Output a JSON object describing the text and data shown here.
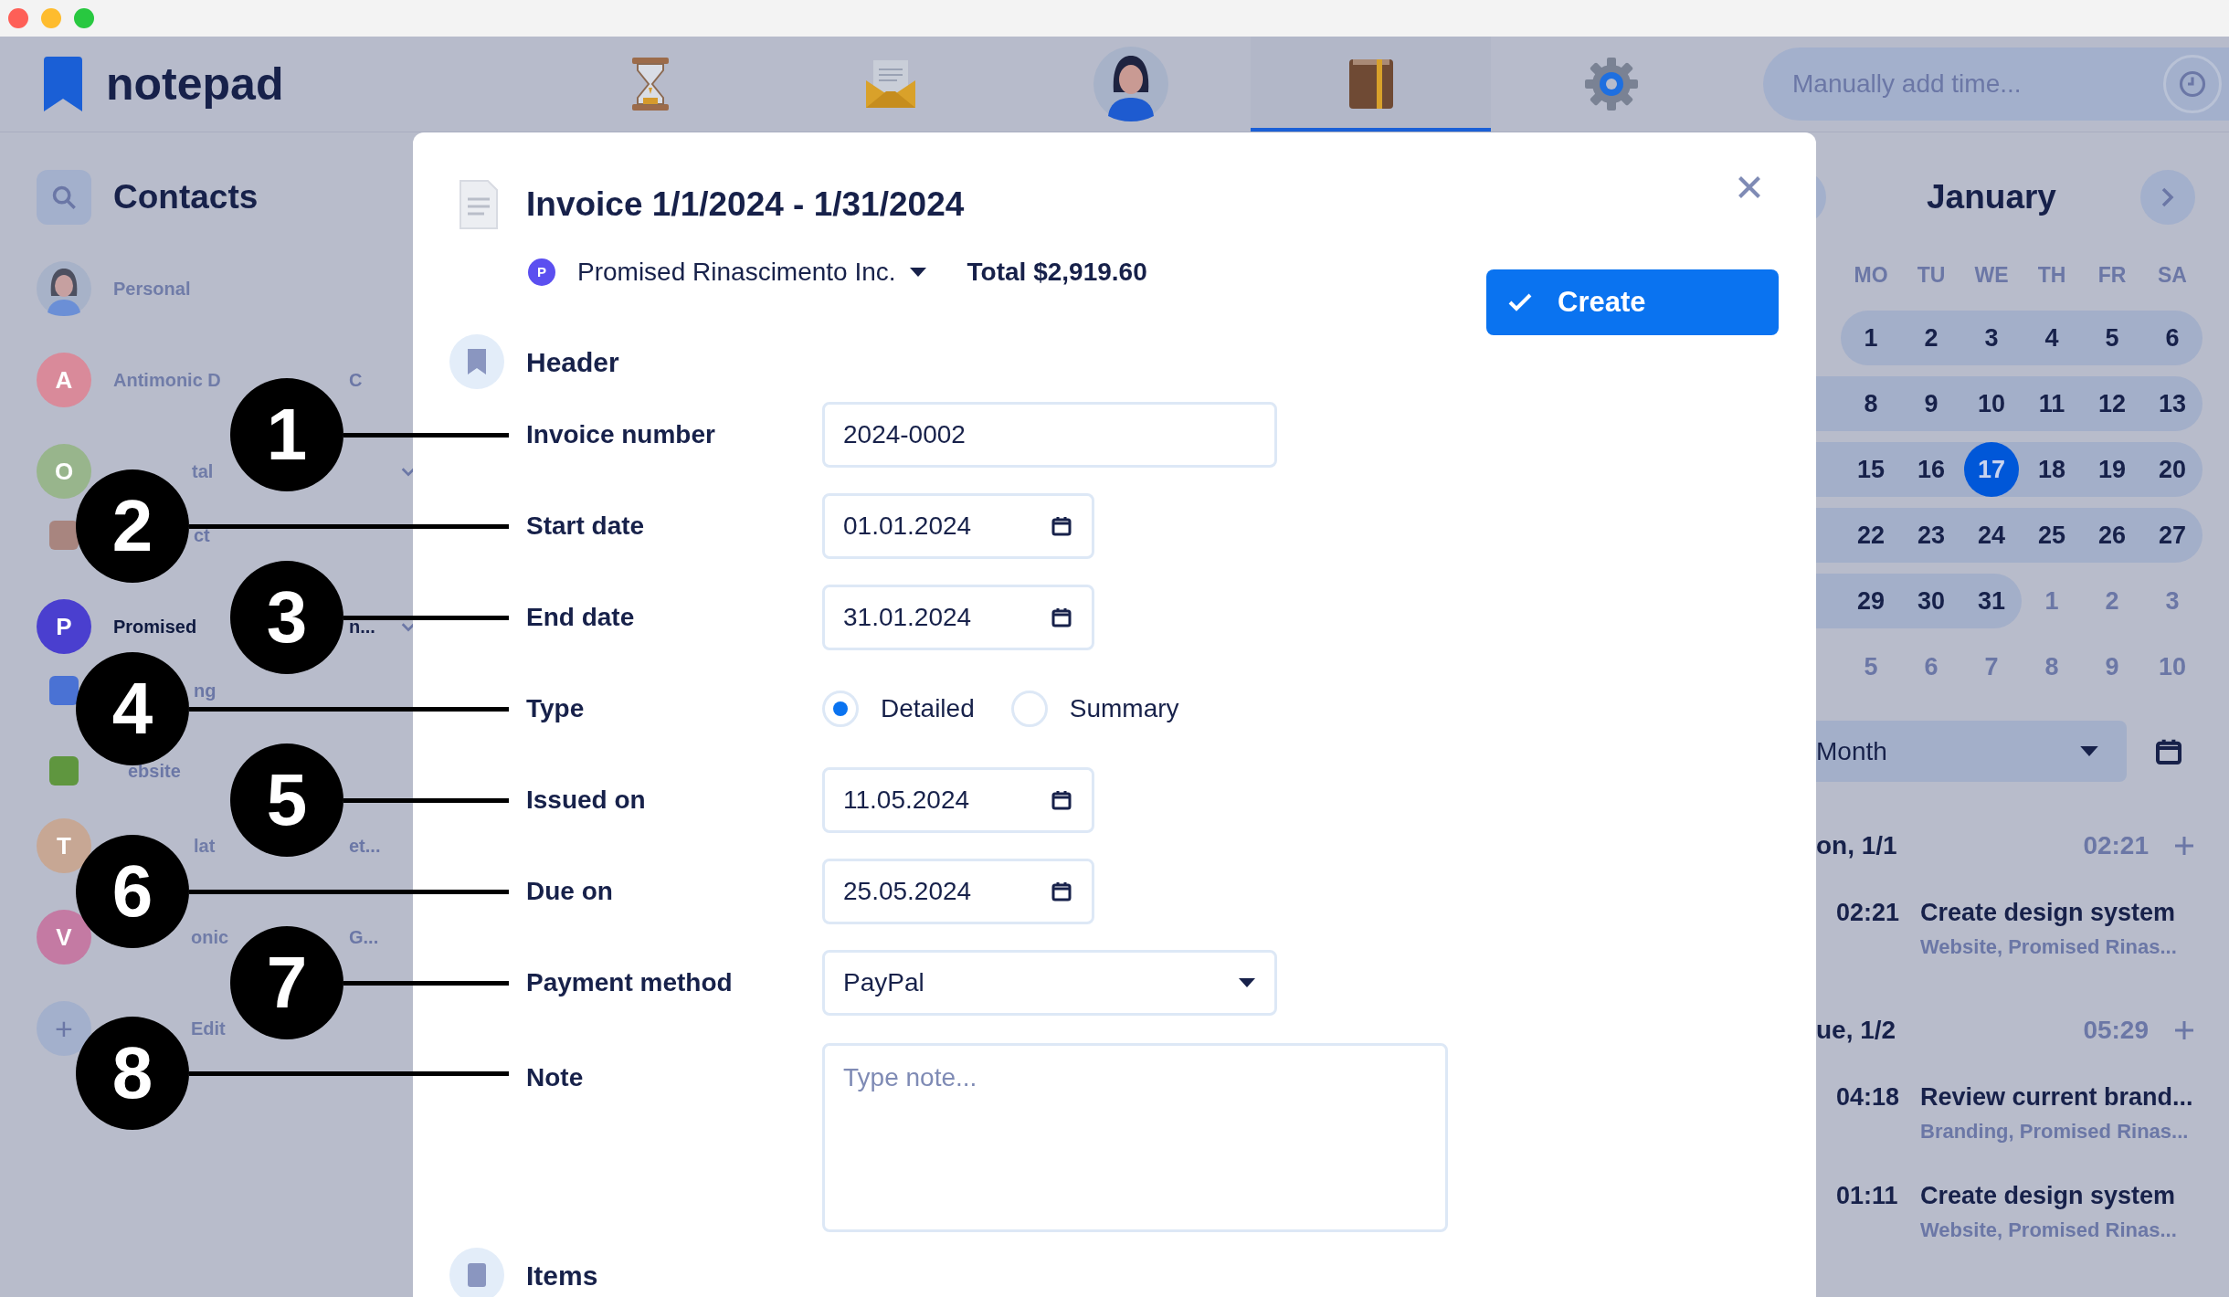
{
  "app_bar": {
    "logo": "notepad",
    "nav": [
      {
        "kind": "hourglass",
        "selected": false
      },
      {
        "kind": "envelope",
        "selected": false
      },
      {
        "kind": "avatar",
        "selected": false
      },
      {
        "kind": "book",
        "selected": true
      },
      {
        "kind": "gear",
        "selected": false
      }
    ],
    "time_field": {
      "placeholder": "Manually add time..."
    }
  },
  "sidebar": {
    "title": "Contacts",
    "items": [
      {
        "kind": "photo",
        "label": "Personal",
        "selected": false
      },
      {
        "kind": "letter",
        "initial": "A",
        "color": "#d98a9a",
        "label": "Antimonic D",
        "tail": "C",
        "selected": false
      },
      {
        "kind": "letter",
        "initial": "O",
        "color": "#98b58c",
        "label": "tal",
        "selected": false,
        "expanded": true,
        "children": [
          {
            "color": "#a8857f",
            "label": "ct"
          }
        ]
      },
      {
        "kind": "letter",
        "initial": "P",
        "color": "#4a3fcf",
        "label": "Promised",
        "tail": "n...",
        "selected": true,
        "expanded": true,
        "children": [
          {
            "color": "#4a72d4",
            "label": "ng"
          },
          {
            "color": "#5f963f",
            "label": "ebsite"
          }
        ]
      },
      {
        "kind": "letter",
        "initial": "T",
        "color": "#c7a794",
        "label": "lat",
        "tail": "et...",
        "selected": false
      },
      {
        "kind": "letter",
        "initial": "V",
        "color": "#c47aa3",
        "label": "onic",
        "tail": "G...",
        "selected": false
      },
      {
        "kind": "add",
        "initial": "+",
        "label": "Edit",
        "selected": false
      }
    ]
  },
  "modal": {
    "title": "Invoice 1/1/2024 - 1/31/2024",
    "client": {
      "initial": "P",
      "color": "#5b4ff0",
      "name": "Promised Rinascimento Inc."
    },
    "total": "Total $2,919.60",
    "create_button": "Create",
    "header_section": "Header",
    "fields": [
      {
        "callout": "1",
        "label": "Invoice number",
        "kind": "text",
        "value": "2024-0002"
      },
      {
        "callout": "2",
        "label": "Start date",
        "kind": "date",
        "value": "01.01.2024"
      },
      {
        "callout": "3",
        "label": "End date",
        "kind": "date",
        "value": "31.01.2024"
      },
      {
        "callout": "4",
        "label": "Type",
        "kind": "radio",
        "options": [
          {
            "label": "Detailed",
            "selected": true
          },
          {
            "label": "Summary",
            "selected": false
          }
        ]
      },
      {
        "callout": "5",
        "label": "Issued on",
        "kind": "date",
        "value": "11.05.2024"
      },
      {
        "callout": "6",
        "label": "Due on",
        "kind": "date",
        "value": "25.05.2024"
      },
      {
        "callout": "7",
        "label": "Payment method",
        "kind": "select",
        "value": "PayPal"
      },
      {
        "callout": "8",
        "label": "Note",
        "kind": "textarea",
        "placeholder": "Type note..."
      }
    ],
    "items_section": "Items"
  },
  "calendar": {
    "month": "January",
    "weekdays": [
      "MO",
      "TU",
      "WE",
      "TH",
      "FR",
      "SA"
    ],
    "weeks": [
      [
        {
          "label": "1",
          "in_month": true,
          "selected": false
        },
        {
          "label": "2",
          "in_month": true,
          "selected": false
        },
        {
          "label": "3",
          "in_month": true,
          "selected": false
        },
        {
          "label": "4",
          "in_month": true,
          "selected": false
        },
        {
          "label": "5",
          "in_month": true,
          "selected": false
        },
        {
          "label": "6",
          "in_month": true,
          "selected": false
        }
      ],
      [
        {
          "label": "8",
          "in_month": true,
          "selected": false
        },
        {
          "label": "9",
          "in_month": true,
          "selected": false
        },
        {
          "label": "10",
          "in_month": true,
          "selected": false
        },
        {
          "label": "11",
          "in_month": true,
          "selected": false
        },
        {
          "label": "12",
          "in_month": true,
          "selected": false
        },
        {
          "label": "13",
          "in_month": true,
          "selected": false
        }
      ],
      [
        {
          "label": "15",
          "in_month": true,
          "selected": false
        },
        {
          "label": "16",
          "in_month": true,
          "selected": false
        },
        {
          "label": "17",
          "in_month": true,
          "selected": true
        },
        {
          "label": "18",
          "in_month": true,
          "selected": false
        },
        {
          "label": "19",
          "in_month": true,
          "selected": false
        },
        {
          "label": "20",
          "in_month": true,
          "selected": false
        }
      ],
      [
        {
          "label": "22",
          "in_month": true,
          "selected": false
        },
        {
          "label": "23",
          "in_month": true,
          "selected": false
        },
        {
          "label": "24",
          "in_month": true,
          "selected": false
        },
        {
          "label": "25",
          "in_month": true,
          "selected": false
        },
        {
          "label": "26",
          "in_month": true,
          "selected": false
        },
        {
          "label": "27",
          "in_month": true,
          "selected": false
        }
      ],
      [
        {
          "label": "29",
          "in_month": true,
          "selected": false
        },
        {
          "label": "30",
          "in_month": true,
          "selected": false
        },
        {
          "label": "31",
          "in_month": true,
          "selected": false
        },
        {
          "label": "1",
          "in_month": false,
          "selected": false
        },
        {
          "label": "2",
          "in_month": false,
          "selected": false
        },
        {
          "label": "3",
          "in_month": false,
          "selected": false
        }
      ],
      [
        {
          "label": "5",
          "in_month": false,
          "selected": false
        },
        {
          "label": "6",
          "in_month": false,
          "selected": false
        },
        {
          "label": "7",
          "in_month": false,
          "selected": false
        },
        {
          "label": "8",
          "in_month": false,
          "selected": false
        },
        {
          "label": "9",
          "in_month": false,
          "selected": false
        },
        {
          "label": "10",
          "in_month": false,
          "selected": false
        }
      ]
    ],
    "view_select": "Month",
    "days": [
      {
        "date": "on, 1/1",
        "total": "02:21",
        "entries": [
          {
            "time": "02:21",
            "title": "Create design system",
            "meta": "Website, Promised Rinas..."
          }
        ]
      },
      {
        "date": "ue, 1/2",
        "total": "05:29",
        "entries": [
          {
            "time": "04:18",
            "title": "Review current brand...",
            "meta": "Branding, Promised Rinas..."
          },
          {
            "time": "01:11",
            "title": "Create design system",
            "meta": "Website, Promised Rinas..."
          }
        ]
      }
    ]
  }
}
